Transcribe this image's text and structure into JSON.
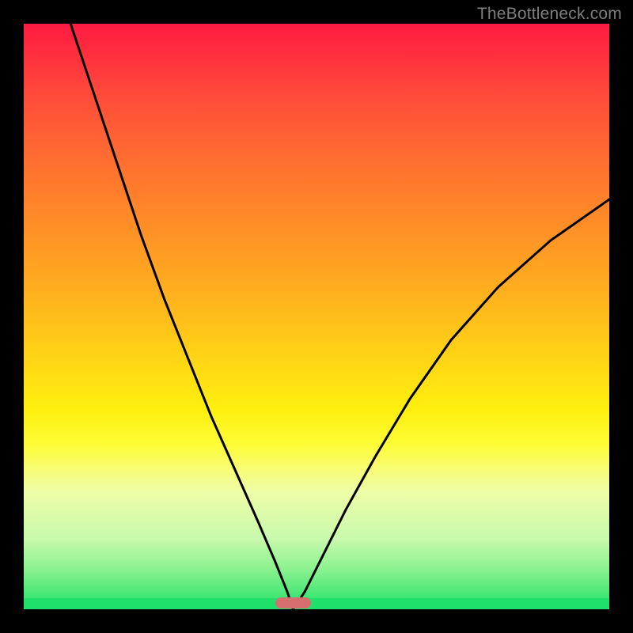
{
  "watermark": "TheBottleneck.com",
  "colors": {
    "frame": "#000000",
    "gradient_top": "#ff1b42",
    "gradient_mid": "#ffd116",
    "gradient_bottom": "#1ee06a",
    "curve": "#000000",
    "marker": "#d76f6f"
  },
  "chart_data": {
    "type": "line",
    "title": "",
    "xlabel": "",
    "ylabel": "",
    "xlim": [
      0,
      100
    ],
    "ylim": [
      0,
      100
    ],
    "grid": false,
    "legend": false,
    "annotations": [
      {
        "text": "TheBottleneck.com",
        "position": "top-right"
      }
    ],
    "minimum": {
      "x": 46,
      "y": 0
    },
    "marker": {
      "x_center": 46,
      "width_x_units": 6,
      "y": 0
    },
    "series": [
      {
        "name": "left-branch",
        "x": [
          8,
          12,
          16,
          20,
          24,
          28,
          32,
          36,
          40,
          43,
          45,
          46
        ],
        "y": [
          100,
          88,
          76,
          64,
          53,
          43,
          33,
          24,
          15,
          8,
          3,
          0
        ]
      },
      {
        "name": "right-branch",
        "x": [
          46,
          48,
          51,
          55,
          60,
          66,
          73,
          81,
          90,
          100
        ],
        "y": [
          0,
          3,
          9,
          17,
          26,
          36,
          46,
          55,
          63,
          70
        ]
      }
    ]
  }
}
